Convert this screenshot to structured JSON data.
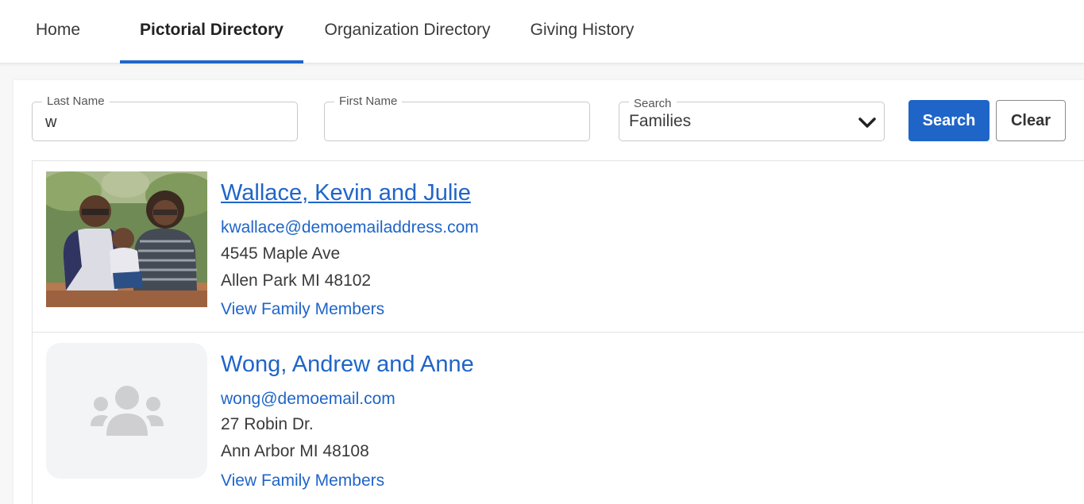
{
  "nav": {
    "tabs": [
      {
        "label": "Home"
      },
      {
        "label": "Pictorial Directory"
      },
      {
        "label": "Organization Directory"
      },
      {
        "label": "Giving History"
      }
    ]
  },
  "search": {
    "last_name_label": "Last Name",
    "last_name_value": "w",
    "first_name_label": "First Name",
    "first_name_value": "",
    "type_label": "Search",
    "type_value": "Families",
    "search_button": "Search",
    "clear_button": "Clear"
  },
  "results": [
    {
      "name": "Wallace, Kevin and Julie",
      "email": "kwallace@demoemailaddress.com",
      "address_line1": "4545 Maple Ave",
      "address_line2": "Allen Park MI 48102",
      "view_link": "View Family Members",
      "photo": "family-photo"
    },
    {
      "name": "Wong, Andrew and Anne",
      "email": "wong@demoemail.com",
      "address_line1": "27 Robin Dr.",
      "address_line2": "Ann Arbor MI 48108",
      "view_link": "View Family Members",
      "photo": "family-placeholder-icon"
    }
  ],
  "colors": {
    "accent": "#1f65c8",
    "text": "#3a3a3a",
    "border": "#c9c9c9",
    "placeholder_bg": "#f3f4f6",
    "placeholder_icon": "#cfcfd1"
  }
}
